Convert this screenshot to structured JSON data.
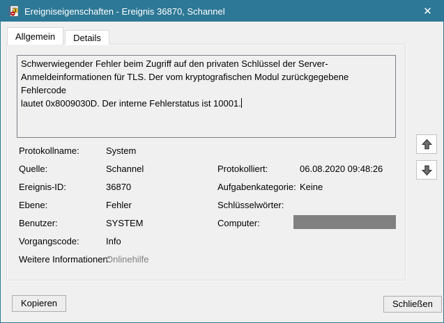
{
  "window": {
    "title": "Ereigniseigenschaften - Ereignis 36870, Schannel",
    "close_glyph": "✕"
  },
  "tabs": [
    {
      "label": "Allgemein",
      "active": true
    },
    {
      "label": "Details",
      "active": false
    }
  ],
  "description": {
    "text": "Schwerwiegender Fehler beim Zugriff auf den privaten Schlüssel der Server-\nAnmeldeinformationen für TLS. Der vom kryptografischen Modul zurückgegebene Fehlercode\nlautet 0x8009030D. Der interne Fehlerstatus ist 10001."
  },
  "fields": {
    "left": [
      {
        "label": "Protokollname:",
        "value": "System"
      },
      {
        "label": "Quelle:",
        "value": "Schannel"
      },
      {
        "label": "Ereignis-ID:",
        "value": "36870"
      },
      {
        "label": "Ebene:",
        "value": "Fehler"
      },
      {
        "label": "Benutzer:",
        "value": "SYSTEM"
      },
      {
        "label": "Vorgangscode:",
        "value": "Info"
      },
      {
        "label": "Weitere Informationen:",
        "value": "Onlinehilfe"
      }
    ],
    "right": [
      {
        "label": "Protokolliert:",
        "value": "06.08.2020 09:48:26"
      },
      {
        "label": "Aufgabenkategorie:",
        "value": "Keine"
      },
      {
        "label": "Schlüsselwörter:",
        "value": ""
      },
      {
        "label": "Computer:",
        "value": ""
      }
    ]
  },
  "buttons": {
    "copy": "Kopieren",
    "close": "Schließen"
  },
  "icons": {
    "titlebar": "event-properties-icon",
    "up": "up-arrow-icon",
    "down": "down-arrow-icon"
  },
  "colors": {
    "titlebar": "#2d7896",
    "dialog_bg": "#f0f0f0",
    "redacted_box": "#808080",
    "link_gray": "#808080",
    "error_red": "#c01818",
    "warning_yellow": "#f5c324"
  }
}
